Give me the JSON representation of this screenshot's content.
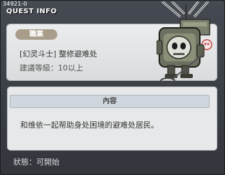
{
  "quest_id": "34921-0",
  "window_title": "QUEST INFO",
  "job_badge": "職業",
  "quest_name": "[幻灵斗士] 整修避难处",
  "level_requirement": "建議等級：10以上",
  "content_header": "內容",
  "description": "和维依一起帮助身处困境的避难处居民。",
  "status": "狀態：可開始",
  "npc_icon": "robot-npc-icon"
}
